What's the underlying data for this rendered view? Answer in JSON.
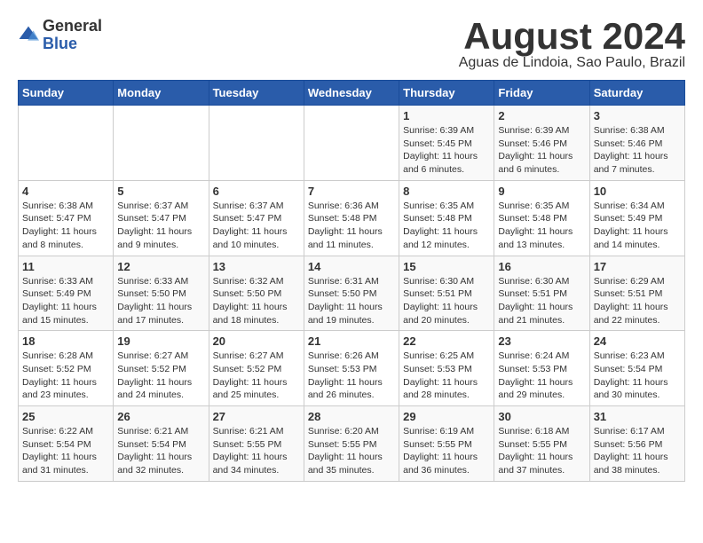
{
  "header": {
    "logo_general": "General",
    "logo_blue": "Blue",
    "month_title": "August 2024",
    "subtitle": "Aguas de Lindoia, Sao Paulo, Brazil"
  },
  "days_of_week": [
    "Sunday",
    "Monday",
    "Tuesday",
    "Wednesday",
    "Thursday",
    "Friday",
    "Saturday"
  ],
  "weeks": [
    [
      {
        "day": "",
        "info": ""
      },
      {
        "day": "",
        "info": ""
      },
      {
        "day": "",
        "info": ""
      },
      {
        "day": "",
        "info": ""
      },
      {
        "day": "1",
        "info": "Sunrise: 6:39 AM\nSunset: 5:45 PM\nDaylight: 11 hours and 6 minutes."
      },
      {
        "day": "2",
        "info": "Sunrise: 6:39 AM\nSunset: 5:46 PM\nDaylight: 11 hours and 6 minutes."
      },
      {
        "day": "3",
        "info": "Sunrise: 6:38 AM\nSunset: 5:46 PM\nDaylight: 11 hours and 7 minutes."
      }
    ],
    [
      {
        "day": "4",
        "info": "Sunrise: 6:38 AM\nSunset: 5:47 PM\nDaylight: 11 hours and 8 minutes."
      },
      {
        "day": "5",
        "info": "Sunrise: 6:37 AM\nSunset: 5:47 PM\nDaylight: 11 hours and 9 minutes."
      },
      {
        "day": "6",
        "info": "Sunrise: 6:37 AM\nSunset: 5:47 PM\nDaylight: 11 hours and 10 minutes."
      },
      {
        "day": "7",
        "info": "Sunrise: 6:36 AM\nSunset: 5:48 PM\nDaylight: 11 hours and 11 minutes."
      },
      {
        "day": "8",
        "info": "Sunrise: 6:35 AM\nSunset: 5:48 PM\nDaylight: 11 hours and 12 minutes."
      },
      {
        "day": "9",
        "info": "Sunrise: 6:35 AM\nSunset: 5:48 PM\nDaylight: 11 hours and 13 minutes."
      },
      {
        "day": "10",
        "info": "Sunrise: 6:34 AM\nSunset: 5:49 PM\nDaylight: 11 hours and 14 minutes."
      }
    ],
    [
      {
        "day": "11",
        "info": "Sunrise: 6:33 AM\nSunset: 5:49 PM\nDaylight: 11 hours and 15 minutes."
      },
      {
        "day": "12",
        "info": "Sunrise: 6:33 AM\nSunset: 5:50 PM\nDaylight: 11 hours and 17 minutes."
      },
      {
        "day": "13",
        "info": "Sunrise: 6:32 AM\nSunset: 5:50 PM\nDaylight: 11 hours and 18 minutes."
      },
      {
        "day": "14",
        "info": "Sunrise: 6:31 AM\nSunset: 5:50 PM\nDaylight: 11 hours and 19 minutes."
      },
      {
        "day": "15",
        "info": "Sunrise: 6:30 AM\nSunset: 5:51 PM\nDaylight: 11 hours and 20 minutes."
      },
      {
        "day": "16",
        "info": "Sunrise: 6:30 AM\nSunset: 5:51 PM\nDaylight: 11 hours and 21 minutes."
      },
      {
        "day": "17",
        "info": "Sunrise: 6:29 AM\nSunset: 5:51 PM\nDaylight: 11 hours and 22 minutes."
      }
    ],
    [
      {
        "day": "18",
        "info": "Sunrise: 6:28 AM\nSunset: 5:52 PM\nDaylight: 11 hours and 23 minutes."
      },
      {
        "day": "19",
        "info": "Sunrise: 6:27 AM\nSunset: 5:52 PM\nDaylight: 11 hours and 24 minutes."
      },
      {
        "day": "20",
        "info": "Sunrise: 6:27 AM\nSunset: 5:52 PM\nDaylight: 11 hours and 25 minutes."
      },
      {
        "day": "21",
        "info": "Sunrise: 6:26 AM\nSunset: 5:53 PM\nDaylight: 11 hours and 26 minutes."
      },
      {
        "day": "22",
        "info": "Sunrise: 6:25 AM\nSunset: 5:53 PM\nDaylight: 11 hours and 28 minutes."
      },
      {
        "day": "23",
        "info": "Sunrise: 6:24 AM\nSunset: 5:53 PM\nDaylight: 11 hours and 29 minutes."
      },
      {
        "day": "24",
        "info": "Sunrise: 6:23 AM\nSunset: 5:54 PM\nDaylight: 11 hours and 30 minutes."
      }
    ],
    [
      {
        "day": "25",
        "info": "Sunrise: 6:22 AM\nSunset: 5:54 PM\nDaylight: 11 hours and 31 minutes."
      },
      {
        "day": "26",
        "info": "Sunrise: 6:21 AM\nSunset: 5:54 PM\nDaylight: 11 hours and 32 minutes."
      },
      {
        "day": "27",
        "info": "Sunrise: 6:21 AM\nSunset: 5:55 PM\nDaylight: 11 hours and 34 minutes."
      },
      {
        "day": "28",
        "info": "Sunrise: 6:20 AM\nSunset: 5:55 PM\nDaylight: 11 hours and 35 minutes."
      },
      {
        "day": "29",
        "info": "Sunrise: 6:19 AM\nSunset: 5:55 PM\nDaylight: 11 hours and 36 minutes."
      },
      {
        "day": "30",
        "info": "Sunrise: 6:18 AM\nSunset: 5:55 PM\nDaylight: 11 hours and 37 minutes."
      },
      {
        "day": "31",
        "info": "Sunrise: 6:17 AM\nSunset: 5:56 PM\nDaylight: 11 hours and 38 minutes."
      }
    ]
  ]
}
